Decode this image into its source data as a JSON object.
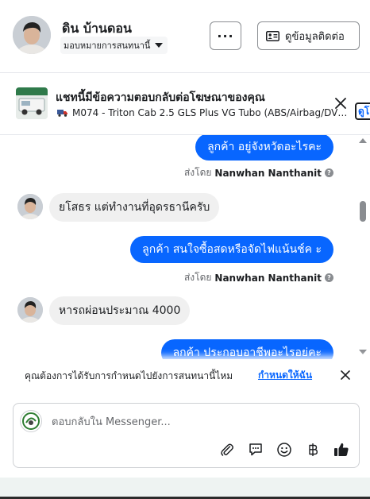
{
  "header": {
    "contact_name": "ดิน บ้านดอน",
    "assign_label": "มอบหมายการสนทนานี้",
    "more_label": "···",
    "view_contact_label": "ดูข้อมูลติดต่อ"
  },
  "ad_banner": {
    "title": "แชทนี้มีข้อความตอบกลับต่อโฆษณาของคุณ",
    "vehicle_text": "M074 - Triton Cab 2.5 GLS Plus VG Tubo (ABS/Airbag/DVD/C...",
    "peek_button_label": "ดูโ"
  },
  "messages": [
    {
      "direction": "out",
      "text": "ลูกค้า  อยู่จังหวัดอะไรคะ"
    },
    {
      "direction": "meta",
      "prefix": "ส่งโดย",
      "sender": "Nanwhan Nanthanit"
    },
    {
      "direction": "in",
      "text": "ยโสธร แต่ทำงานที่อุดรธานีครับ"
    },
    {
      "direction": "out",
      "text": "ลูกค้า สนใจซื้อสดหรือจัดไฟแน้นช์ค ะ"
    },
    {
      "direction": "meta",
      "prefix": "ส่งโดย",
      "sender": "Nanwhan Nanthanit"
    },
    {
      "direction": "in",
      "text": "หารถผ่อนประมาณ 4000"
    },
    {
      "direction": "out",
      "text": "ลกค้า ประกอบอาชีพอะไรอย่คะ"
    }
  ],
  "suggestion": {
    "text": "คุณต้องการได้รับการกำหนดไปยังการสนทนานี้ไหม",
    "link_label": "กำหนดให้ฉัน"
  },
  "composer": {
    "placeholder": "ตอบกลับใน Messenger..."
  },
  "colors": {
    "accent": "#0866ff",
    "bubble_in": "#f0f0f0",
    "border": "#ced0d4"
  }
}
